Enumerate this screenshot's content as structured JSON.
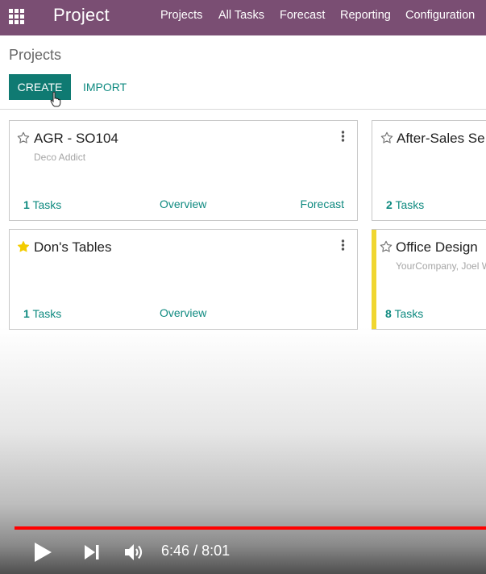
{
  "app": {
    "title": "Project"
  },
  "nav": {
    "items": [
      "Projects",
      "All Tasks",
      "Forecast",
      "Reporting",
      "Configuration"
    ]
  },
  "control_panel": {
    "breadcrumb": "Projects",
    "create_label": "CREATE",
    "import_label": "IMPORT"
  },
  "cards": [
    {
      "title": "AGR - SO104",
      "customer": "Deco Addict",
      "task_count": "1",
      "tasks_label": "Tasks",
      "overview_label": "Overview",
      "forecast_label": "Forecast",
      "favorite": false
    },
    {
      "title": "After-Sales Se",
      "customer": "",
      "task_count": "2",
      "tasks_label": "Tasks",
      "favorite": false
    },
    {
      "title": "Don's Tables",
      "customer": "",
      "task_count": "1",
      "tasks_label": "Tasks",
      "overview_label": "Overview",
      "favorite": true
    },
    {
      "title": "Office Design",
      "customer": "YourCompany, Joel W",
      "task_count": "8",
      "tasks_label": "Tasks",
      "favorite": false,
      "color_tag": "#f0d630"
    }
  ],
  "video": {
    "current_time": "6:46",
    "separator": "/",
    "duration": "8:01",
    "progress": 0.844
  },
  "colors": {
    "navbar": "#7a4e73",
    "primary": "#0f7a72",
    "link": "#0f8a80",
    "progress": "#ff0000"
  },
  "icons": [
    "apps-grid-icon",
    "star-outline-icon",
    "star-filled-icon",
    "kebab-menu-icon",
    "pointer-cursor-icon",
    "play-icon",
    "skip-next-icon",
    "volume-icon"
  ]
}
